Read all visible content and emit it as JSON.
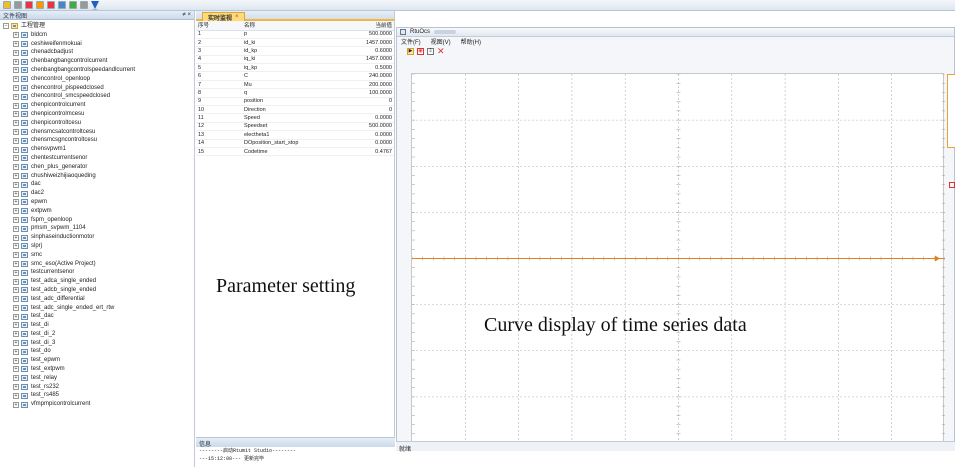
{
  "left_panel": {
    "title": "文件视图",
    "controls": "≠ ×",
    "root": "工程管理",
    "items": [
      "bldcm",
      "ceshiweifenmokuai",
      "chenadcbadjust",
      "chenbangbangcontrolcurrent",
      "chenbangbangcontrolspeedandlcurrent",
      "chencontrol_openloop",
      "chencontrol_pispeedclosed",
      "chencontrol_smcspeedclosed",
      "chenpicontrolcurrent",
      "chenpicontrolmcesu",
      "chenpicontroltcesu",
      "chensmcsatcontroltcesu",
      "chensmcsgncontroltcesu",
      "chensvpwm1",
      "chentestcurrentsenor",
      "chen_plus_generator",
      "chushiweizhijiaoqueding",
      "dac",
      "dac2",
      "epwm",
      "extpwm",
      "fspm_openloop",
      "pmsm_svpwm_1104",
      "sinphaseinductionmotor",
      "slprj",
      "smc",
      "smc_eso(Active Project)",
      "testcurrentsenor",
      "test_adca_single_ended",
      "test_adcb_single_ended",
      "test_adc_differential",
      "test_adc_single_ended_ert_rtw",
      "test_dac",
      "test_di",
      "test_di_2",
      "test_di_3",
      "test_do",
      "test_epwm",
      "test_extpwm",
      "test_relay",
      "test_rs232",
      "test_rs485",
      "vfmpmpicontrolcurrent"
    ]
  },
  "mid_panel": {
    "tab_label": "实时监视",
    "tab_close": "×",
    "headers": [
      "序号",
      "名称",
      "当前值"
    ],
    "rows": [
      [
        "1",
        "p",
        "500.0000"
      ],
      [
        "2",
        "id_ki",
        "1457.0000"
      ],
      [
        "3",
        "id_kp",
        "0.6000"
      ],
      [
        "4",
        "iq_ki",
        "1457.0000"
      ],
      [
        "5",
        "iq_kp",
        "0.5000"
      ],
      [
        "6",
        "C",
        "240.0000"
      ],
      [
        "7",
        "Mu",
        "200.0000"
      ],
      [
        "8",
        "q",
        "100.0000"
      ],
      [
        "9",
        "position",
        "0"
      ],
      [
        "10",
        "Direction",
        "0"
      ],
      [
        "11",
        "Speed",
        "0.0000"
      ],
      [
        "12",
        "Speedset",
        "500.0000"
      ],
      [
        "13",
        "electheta1",
        "0.0000"
      ],
      [
        "14",
        "DOposition_start_stop",
        "0.0000"
      ],
      [
        "15",
        "Codetime",
        "0.4767"
      ]
    ],
    "annotation": "Parameter setting",
    "info_title": "信息",
    "info_lines": [
      "--------启动Rtumit Studio--------",
      "---15:12:00--- 更新完毕"
    ]
  },
  "right_panel": {
    "window_title": "RtuOcs",
    "menu": [
      "文件(F)",
      "视图(V)",
      "帮助(H)"
    ],
    "status": "就绪",
    "annotation": "Curve display of time series data",
    "trace_color": "#e08020"
  }
}
